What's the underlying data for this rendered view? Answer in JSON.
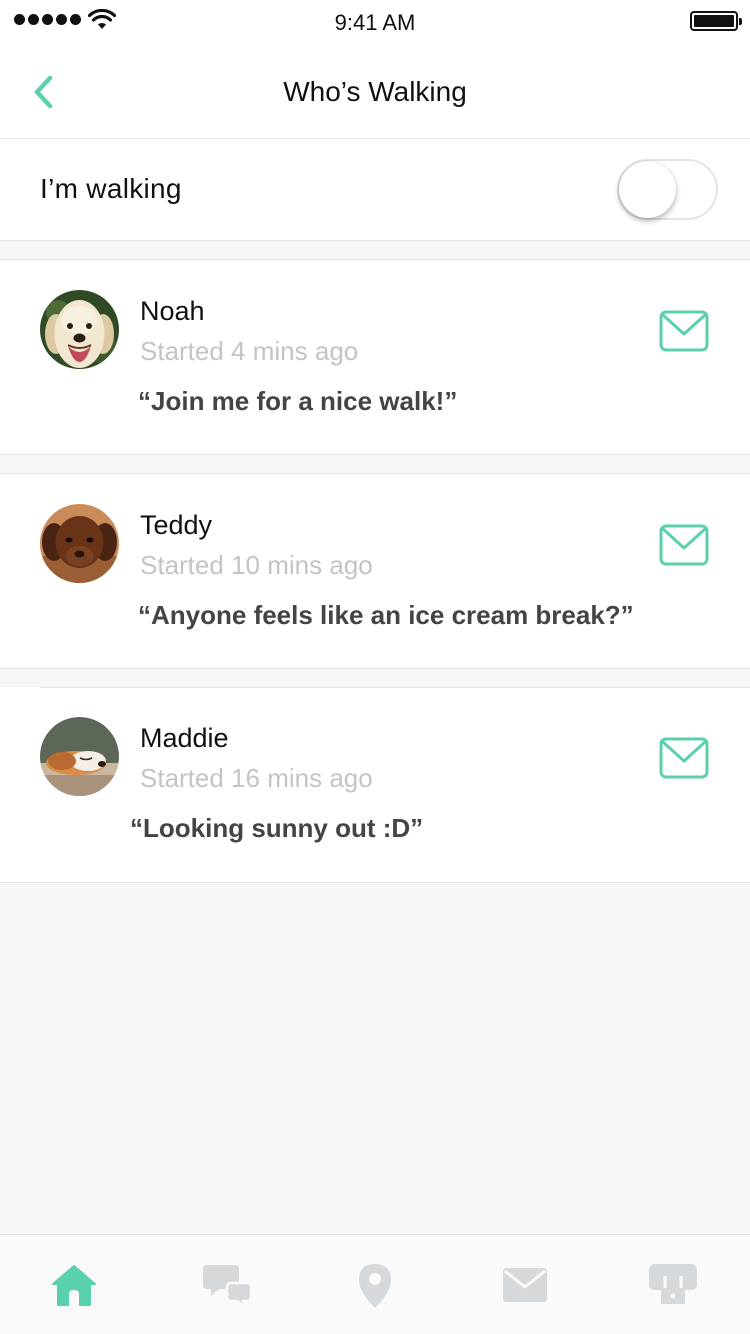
{
  "status_bar": {
    "time": "9:41 AM",
    "signal_icon": "signal-dots-icon",
    "wifi_icon": "wifi-icon",
    "battery_icon": "battery-icon",
    "battery_level": 1.0
  },
  "nav": {
    "title": "Who’s Walking",
    "back_icon": "chevron-left-icon"
  },
  "walk_toggle": {
    "label": "I’m walking",
    "on": false
  },
  "walkers": [
    {
      "name": "Noah",
      "time": "Started 4 mins ago",
      "message": "“Join me for a nice walk!”",
      "avatar": "golden-retriever-avatar"
    },
    {
      "name": "Teddy",
      "time": "Started 10 mins ago",
      "message": "“Anyone feels like an ice cream break?”",
      "avatar": "chocolate-puppy-avatar"
    },
    {
      "name": "Maddie",
      "time": "Started 16 mins ago",
      "message": "“Looking sunny out :D”",
      "avatar": "sleeping-dog-avatar"
    }
  ],
  "tabs": [
    {
      "icon": "home-icon",
      "active": true
    },
    {
      "icon": "chat-bubbles-icon",
      "active": false
    },
    {
      "icon": "map-pin-icon",
      "active": false
    },
    {
      "icon": "mail-icon",
      "active": false
    },
    {
      "icon": "dog-profile-icon",
      "active": false
    }
  ],
  "colors": {
    "accent": "#5bd0ae",
    "inactive_icon": "#d6d9dc",
    "background": "#f6f6f6",
    "secondary_text": "#c4c4c4",
    "message_text": "#444444"
  }
}
